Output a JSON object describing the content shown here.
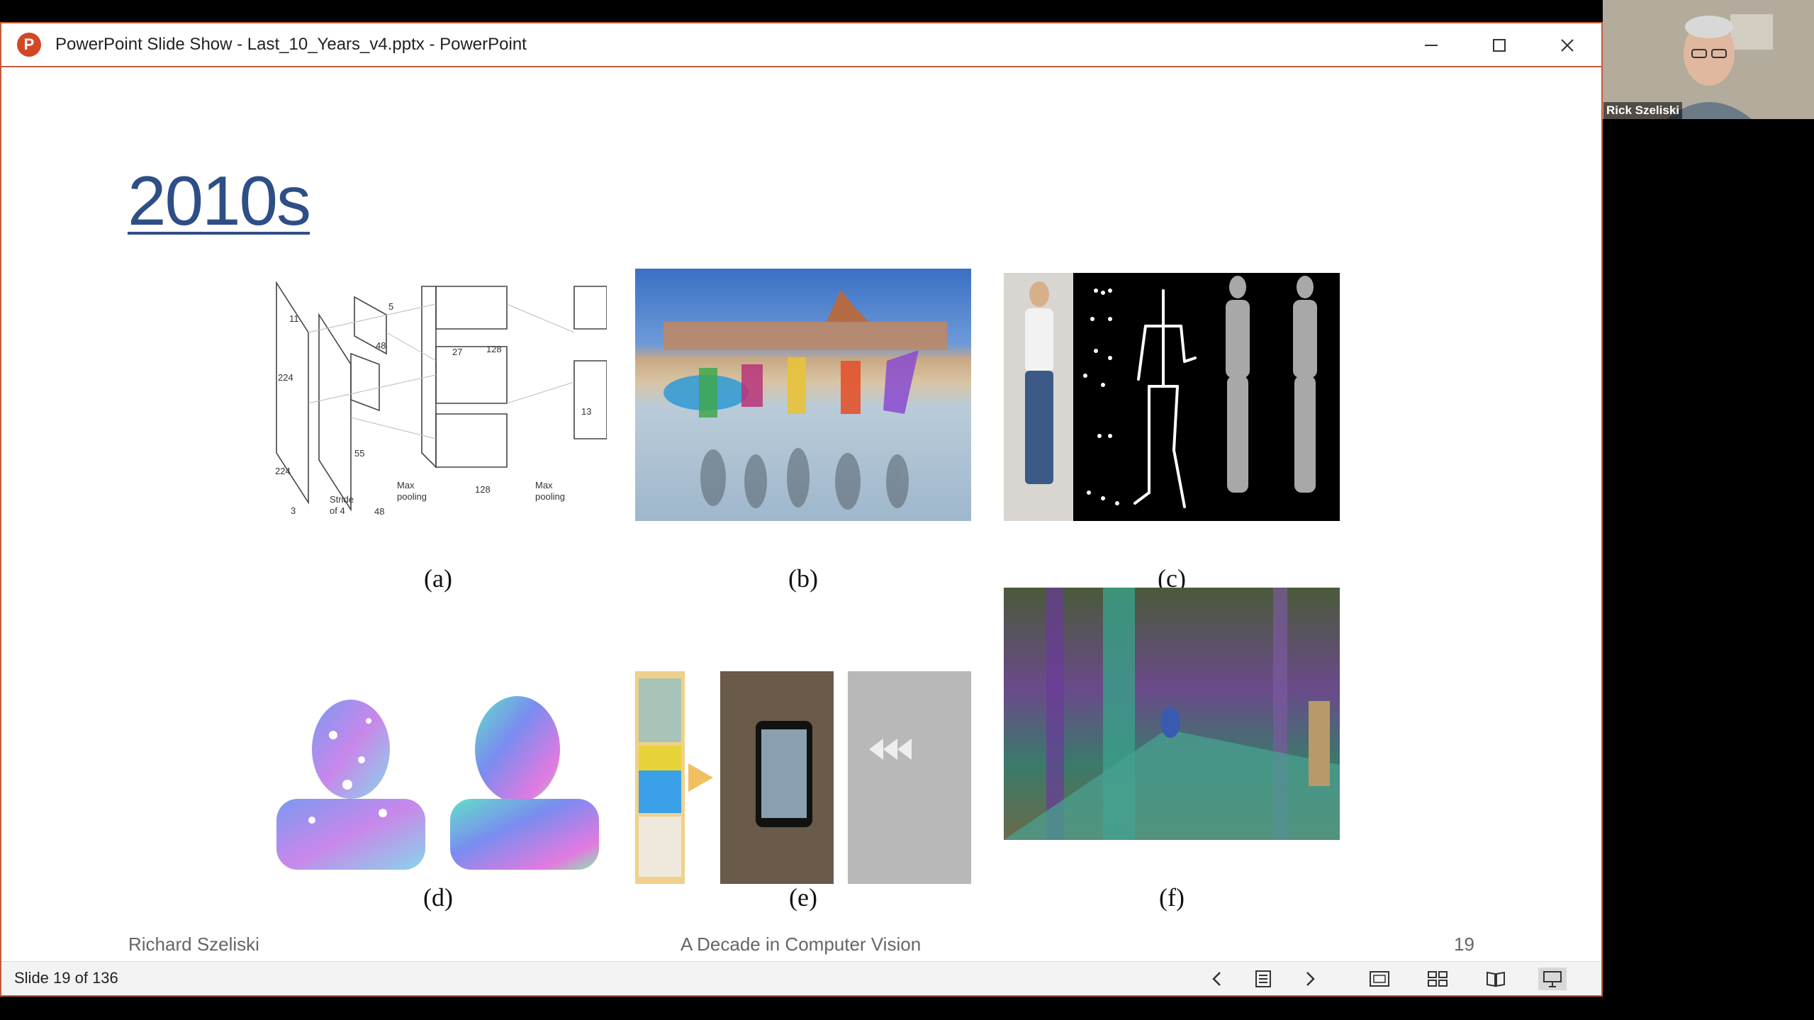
{
  "window": {
    "title": "PowerPoint Slide Show  -  Last_10_Years_v4.pptx - PowerPoint",
    "logo_letter": "P"
  },
  "slide": {
    "title": "2010s",
    "captions": [
      "(a)",
      "(b)",
      "(c)",
      "(d)",
      "(e)",
      "(f)"
    ],
    "fig_a_labels": {
      "n224": "224",
      "n11": "11",
      "n55": "55",
      "n48": "48",
      "n5": "5",
      "n3": "3",
      "n27": "27",
      "n128": "128",
      "n13": "13",
      "stride": "Stride",
      "of4": "of 4",
      "max": "Max",
      "pooling": "pooling"
    },
    "footer": {
      "author": "Richard Szeliski",
      "center": "A Decade in Computer Vision",
      "page": "19"
    }
  },
  "statusbar": {
    "slide_count": "Slide 19 of 136"
  },
  "webcam": {
    "name": "Rick Szeliski"
  }
}
